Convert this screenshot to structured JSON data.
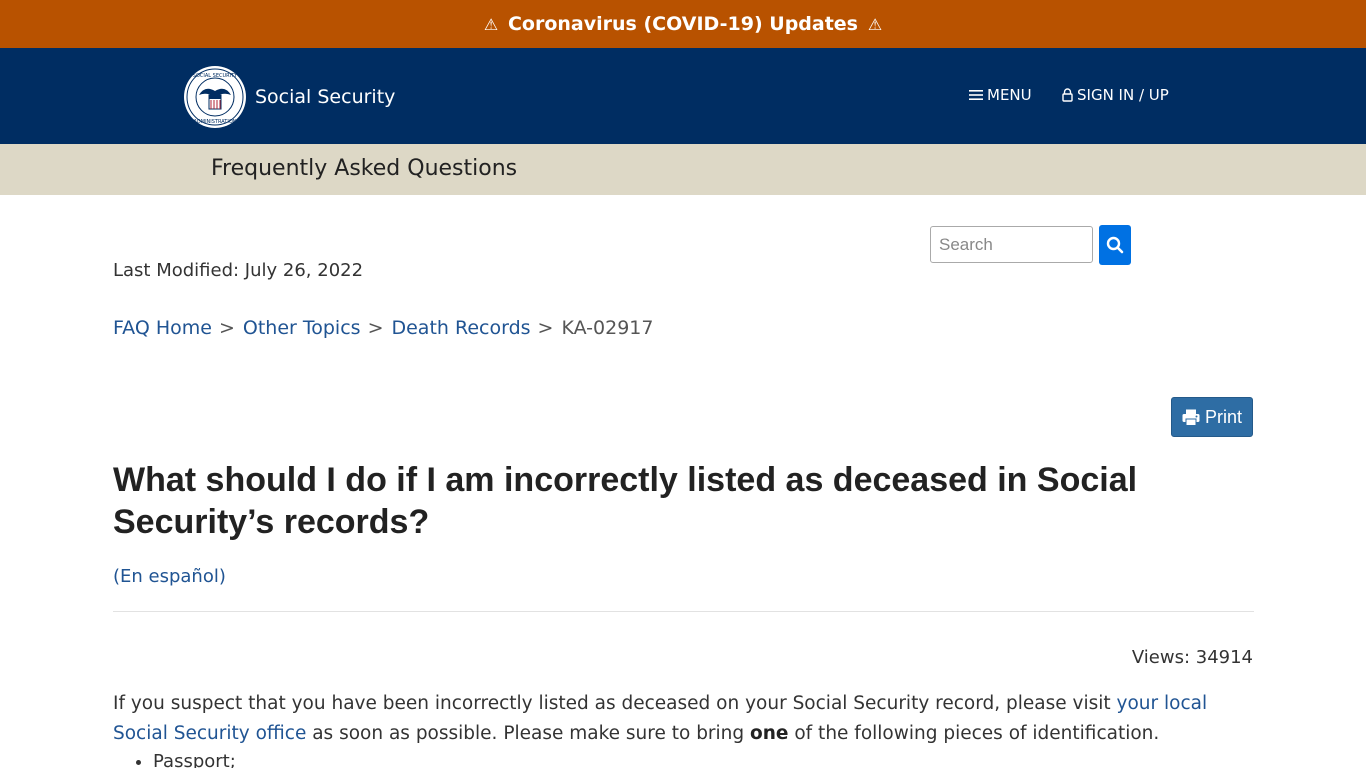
{
  "alert": {
    "text": "Coronavirus (COVID-19) Updates",
    "icon": "warning-triangle-icon",
    "color": "#b85200"
  },
  "header": {
    "brand": "Social Security",
    "logo": "ssa-seal-logo",
    "menu_label": "MENU",
    "signin_label": "SIGN IN / UP",
    "bg_color": "#002d62"
  },
  "subheader": {
    "title": "Frequently Asked Questions"
  },
  "search": {
    "placeholder": "Search",
    "value": ""
  },
  "meta": {
    "last_modified": "Last Modified: July 26, 2022",
    "views": "Views: 34914"
  },
  "breadcrumb": [
    {
      "label": "FAQ Home",
      "link": true
    },
    {
      "label": "Other Topics",
      "link": true
    },
    {
      "label": "Death Records",
      "link": true
    },
    {
      "label": "KA-02917",
      "link": false
    }
  ],
  "breadcrumb_sep": ">",
  "print_label": "Print",
  "article": {
    "title": "What should I do if I am incorrectly listed as deceased in Social Security’s records?",
    "spanish_link": "(En español)",
    "intro_before_link": "If you suspect that you have been incorrectly listed as deceased on your Social Security record, please visit ",
    "intro_link": "your local Social Security office",
    "intro_after_link": " as soon as possible.  Please make sure to bring ",
    "intro_bold": "one",
    "intro_end": " of the following pieces of identification.",
    "list_items": [
      "Passport;"
    ]
  }
}
